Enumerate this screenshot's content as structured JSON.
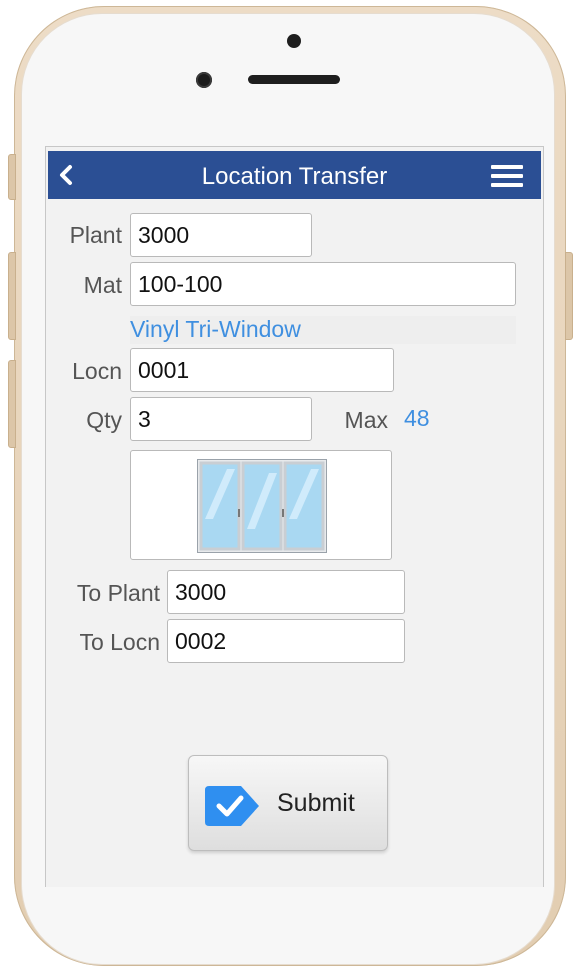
{
  "header": {
    "title": "Location Transfer"
  },
  "form": {
    "plant": {
      "label": "Plant",
      "value": "3000"
    },
    "mat": {
      "label": "Mat",
      "value": "100-100",
      "description": "Vinyl Tri-Window"
    },
    "locn": {
      "label": "Locn",
      "value": "0001"
    },
    "qty": {
      "label": "Qty",
      "value": "3",
      "max_label": "Max",
      "max_value": "48"
    },
    "to_plant": {
      "label": "To Plant",
      "value": "3000"
    },
    "to_locn": {
      "label": "To Locn",
      "value": "0002"
    }
  },
  "actions": {
    "submit_label": "Submit"
  },
  "icons": {
    "back": "chevron-left-icon",
    "menu": "hamburger-menu-icon",
    "submit": "check-tag-icon"
  },
  "colors": {
    "header_bg": "#2b4f94",
    "link_blue": "#3f8fe0",
    "submit_icon": "#2f8ff0"
  }
}
